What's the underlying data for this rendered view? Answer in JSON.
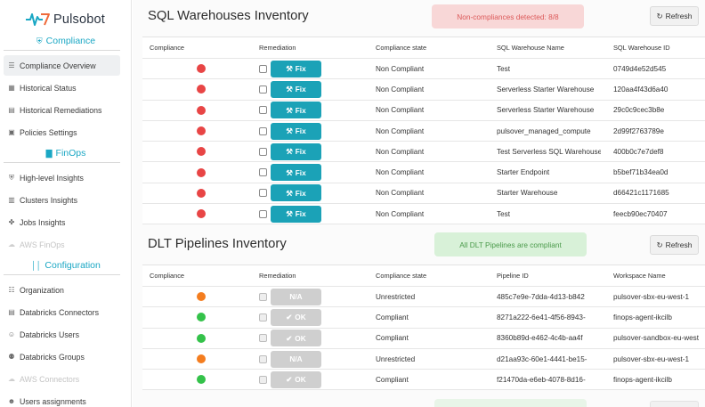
{
  "app": {
    "name": "Pulsobot"
  },
  "sidebar": {
    "sections": [
      {
        "label": "Compliance",
        "icon": "shield-icon"
      },
      {
        "label": "FinOps",
        "icon": "bar-chart-icon"
      },
      {
        "label": "Configuration",
        "icon": "bars-icon"
      }
    ],
    "items": [
      {
        "label": "Compliance Overview",
        "icon": "list-icon"
      },
      {
        "label": "Historical Status",
        "icon": "calendar-icon"
      },
      {
        "label": "Historical Remediations",
        "icon": "document-icon"
      },
      {
        "label": "Policies Settings",
        "icon": "document-check-icon"
      },
      {
        "label": "High-level Insights",
        "icon": "shield-icon"
      },
      {
        "label": "Clusters Insights",
        "icon": "server-icon"
      },
      {
        "label": "Jobs Insights",
        "icon": "network-icon"
      },
      {
        "label": "AWS FinOps",
        "icon": "cloud-icon"
      },
      {
        "label": "Organization",
        "icon": "org-chart-icon"
      },
      {
        "label": "Databricks Connectors",
        "icon": "database-icon"
      },
      {
        "label": "Databricks Users",
        "icon": "users-icon"
      },
      {
        "label": "Databricks Groups",
        "icon": "group-icon"
      },
      {
        "label": "AWS Connectors",
        "icon": "cloud-icon"
      },
      {
        "label": "Users assignments",
        "icon": "user-assign-icon"
      }
    ]
  },
  "sql": {
    "title": "SQL Warehouses Inventory",
    "banner": "Non-compliances detected: 8/8",
    "refresh_label": "Refresh",
    "columns": [
      "Compliance",
      "Remediation",
      "Compliance state",
      "SQL Warehouse Name",
      "SQL Warehouse ID"
    ],
    "rows": [
      {
        "status": "red",
        "action": "Fix",
        "state": "Non Compliant",
        "name": "Test",
        "id": "0749d4e52d545"
      },
      {
        "status": "red",
        "action": "Fix",
        "state": "Non Compliant",
        "name": "Serverless Starter Warehouse",
        "id": "120aa4f43d6a40"
      },
      {
        "status": "red",
        "action": "Fix",
        "state": "Non Compliant",
        "name": "Serverless Starter Warehouse",
        "id": "29c0c9cec3b8e"
      },
      {
        "status": "red",
        "action": "Fix",
        "state": "Non Compliant",
        "name": "pulsover_managed_compute",
        "id": "2d99f2763789e"
      },
      {
        "status": "red",
        "action": "Fix",
        "state": "Non Compliant",
        "name": "Test Serverless SQL Warehouse",
        "id": "400b0c7e7def8"
      },
      {
        "status": "red",
        "action": "Fix",
        "state": "Non Compliant",
        "name": "Starter Endpoint",
        "id": "b5bef71b34ea0d"
      },
      {
        "status": "red",
        "action": "Fix",
        "state": "Non Compliant",
        "name": "Starter Warehouse",
        "id": "d66421c1171685"
      },
      {
        "status": "red",
        "action": "Fix",
        "state": "Non Compliant",
        "name": "Test",
        "id": "feecb90ec70407"
      }
    ]
  },
  "dlt": {
    "title": "DLT Pipelines Inventory",
    "banner": "All DLT Pipelines are compliant",
    "refresh_label": "Refresh",
    "columns": [
      "Compliance",
      "Remediation",
      "Compliance state",
      "Pipeline ID",
      "Workspace Name"
    ],
    "rows": [
      {
        "status": "orange",
        "action": "N/A",
        "state": "Unrestricted",
        "pipeline_id": "485c7e9e-7dda-4d13-b842",
        "workspace": "pulsover-sbx-eu-west-1"
      },
      {
        "status": "green",
        "action": "OK",
        "state": "Compliant",
        "pipeline_id": "8271a222-6e41-4f56-8943-",
        "workspace": "finops-agent-ikcilb"
      },
      {
        "status": "green",
        "action": "OK",
        "state": "Compliant",
        "pipeline_id": "8360b89d-e462-4c4b-aa4f",
        "workspace": "pulsover-sandbox-eu-west"
      },
      {
        "status": "orange",
        "action": "N/A",
        "state": "Unrestricted",
        "pipeline_id": "d21aa93c-60e1-4441-be15-",
        "workspace": "pulsover-sbx-eu-west-1"
      },
      {
        "status": "green",
        "action": "OK",
        "state": "Compliant",
        "pipeline_id": "f21470da-e6eb-4078-8d16-",
        "workspace": "finops-agent-ikcilb"
      }
    ]
  },
  "colors": {
    "accent": "#1ba2b7",
    "non_compliant": "#e84545",
    "compliant": "#34c24a",
    "unrestricted": "#f47d1f"
  }
}
